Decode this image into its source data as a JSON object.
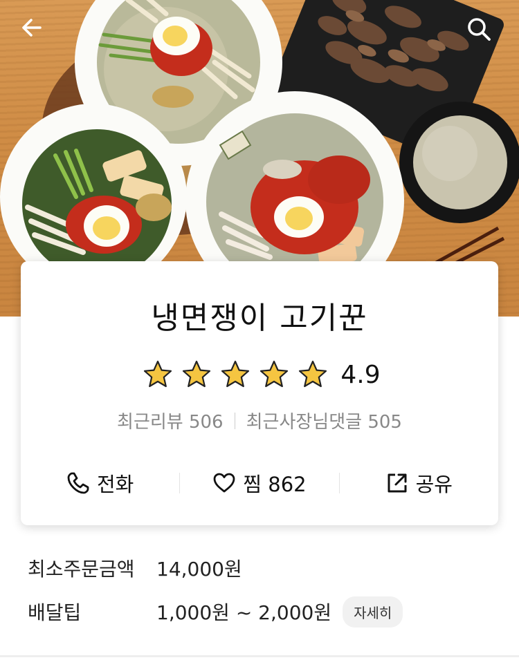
{
  "nav": {
    "back_icon": "arrow-left-icon",
    "search_icon": "search-icon"
  },
  "store": {
    "name": "냉면쟁이 고기꾼",
    "rating": "4.9",
    "stars": 5,
    "recent_reviews": "최근리뷰 506",
    "owner_replies": "최근사장님댓글 505"
  },
  "actions": {
    "call_label": "전화",
    "call_icon": "phone-icon",
    "like_label": "찜 862",
    "like_icon": "heart-icon",
    "share_label": "공유",
    "share_icon": "share-icon"
  },
  "delivery": {
    "min_order_label": "최소주문금액",
    "min_order_value": "14,000원",
    "tip_label": "배달팁",
    "tip_value": "1,000원 ~ 2,000원",
    "detail_label": "자세히"
  },
  "colors": {
    "star_fill": "#f5c541",
    "star_stroke": "#222222",
    "text_gray": "#888888"
  }
}
